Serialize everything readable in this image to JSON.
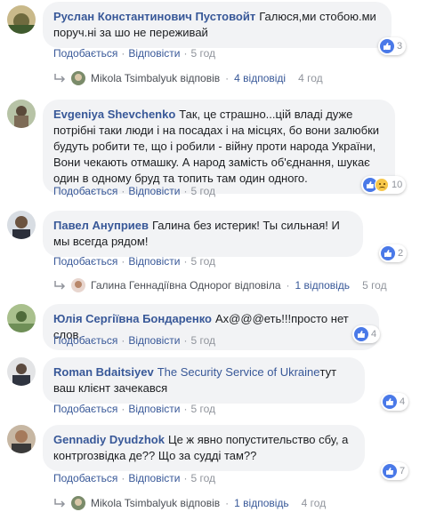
{
  "comments": [
    {
      "author": "Руслан Константинович Пустовойт",
      "text": "Галюся,ми стобою.ми поруч.ні за шо не переживай",
      "reactions": "3",
      "like_label": "Подобається",
      "reply_label": "Відповісти",
      "time": "5 год",
      "replies": {
        "name": "Mikola Tsimbalyuk",
        "verb": "відповів",
        "count": "4 відповіді",
        "time": "4 год"
      }
    },
    {
      "author": "Evgeniya Shevchenko",
      "text": "Так, це страшно...цій владі дуже потрібні таки люди і на посадах і на місцях, бо вони залюбки будуть робити те, що і робили - війну проти народа України, Вони чекають отмашку. А народ замість об'єднання, шукає один в одному бруд та топить там один одного.",
      "reactions": "10",
      "like_label": "Подобається",
      "reply_label": "Відповісти",
      "time": "5 год"
    },
    {
      "author": "Павел Ануприев",
      "text": "Галина без истерик! Ты сильная! И мы всегда рядом!",
      "reactions": "2",
      "like_label": "Подобається",
      "reply_label": "Відповісти",
      "time": "5 год",
      "replies": {
        "name": "Галина Геннадіївна Однорог",
        "verb": "відповіла",
        "count": "1 відповідь",
        "time": "5 год"
      }
    },
    {
      "author": "Юлія Сергіївна Бондаренко",
      "text": "Ах@@@еть!!!просто нет слов.",
      "reactions": "4",
      "like_label": "Подобається",
      "reply_label": "Відповісти",
      "time": "5 год"
    },
    {
      "author": "Roman Bdaitsiyev",
      "mention": "The Security Service of Ukraine",
      "text": "тут ваш клієнт зачекався",
      "reactions": "4",
      "like_label": "Подобається",
      "reply_label": "Відповісти",
      "time": "5 год"
    },
    {
      "author": "Gennadiy Dyudzhok",
      "text": "Це ж явно попустительство сбу, а контрrозвідка де?? Що за судді там??",
      "reactions": "7",
      "like_label": "Подобається",
      "reply_label": "Відповісти",
      "time": "5 год",
      "replies": {
        "name": "Mikola Tsimbalyuk",
        "verb": "відповів",
        "count": "1 відповідь",
        "time": "4 год"
      }
    }
  ],
  "colors": {
    "link": "#385898",
    "bubble": "#f2f3f5",
    "like": "#4a79e8",
    "muted": "#90949c"
  }
}
